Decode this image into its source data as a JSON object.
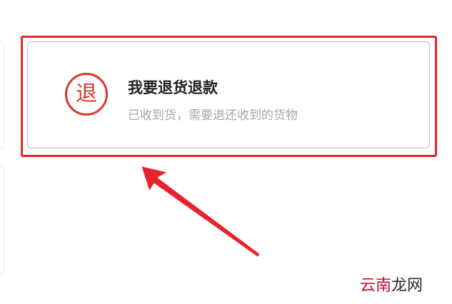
{
  "option": {
    "icon_glyph": "退",
    "title": "我要退货退款",
    "description": "已收到货，需要退还收到的货物"
  },
  "watermark": {
    "red_part": "云南",
    "dark_part": "龙网"
  },
  "colors": {
    "highlight": "#e8232b",
    "icon": "#d9372b",
    "title": "#222222",
    "description": "#a6a6a6"
  }
}
